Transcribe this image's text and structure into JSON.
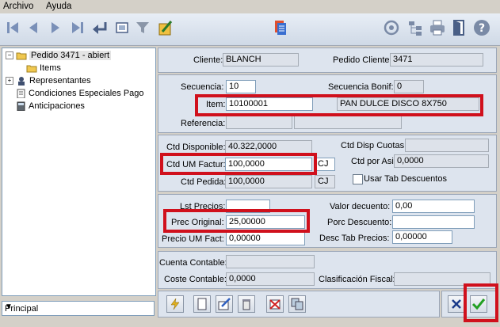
{
  "menu": {
    "archivo": "Archivo",
    "ayuda": "Ayuda"
  },
  "tree": {
    "items": [
      {
        "label": "Pedido 3471 - abiert"
      },
      {
        "label": "Items"
      },
      {
        "label": "Representantes"
      },
      {
        "label": "Condiciones Especiales Pago"
      },
      {
        "label": "Anticipaciones"
      }
    ]
  },
  "combo": {
    "value": "Principal"
  },
  "header": {
    "cliente_label": "Cliente:",
    "cliente_value": "BLANCH",
    "pedido_cliente_label": "Pedido Cliente:",
    "pedido_cliente_value": "3471"
  },
  "item_section": {
    "secuencia_label": "Secuencia:",
    "secuencia_value": "10",
    "secuencia_bonif_label": "Secuencia Bonif:",
    "secuencia_bonif_value": "0",
    "item_label": "Item:",
    "item_value": "10100001",
    "item_description": "PAN DULCE DISCO 8X750",
    "referencia_label": "Referencia:"
  },
  "qty_section": {
    "ctd_disponible_label": "Ctd Disponible:",
    "ctd_disponible_value": "40.322,0000",
    "ctd_disp_cuotas_label": "Ctd Disp Cuotas:",
    "ctd_um_factur_label": "Ctd UM Factur:",
    "ctd_um_factur_value": "100,0000",
    "ctd_um_factur_unit": "CJ",
    "ctd_por_asign_label": "Ctd por Asign:",
    "ctd_por_asign_value": "0,0000",
    "ctd_pedida_label": "Ctd Pedida:",
    "ctd_pedida_value": "100,0000",
    "ctd_pedida_unit": "CJ",
    "usar_tab_descuentos_label": "Usar Tab Descuentos"
  },
  "price_section": {
    "lst_precios_label": "Lst Precios:",
    "valor_descuento_label": "Valor decuento:",
    "valor_descuento_value": "0,00",
    "porc_descuento_label": "Porc Descuento:",
    "prec_original_label": "Prec Original:",
    "prec_original_value": "25,00000",
    "precio_um_fact_label": "Precio UM Fact:",
    "precio_um_fact_value": "0,00000",
    "desc_tab_precios_label": "Desc Tab Precios:",
    "desc_tab_precios_value": "0,00000"
  },
  "accounting": {
    "cuenta_contable_label": "Cuenta Contable:",
    "coste_contable_label": "Coste Contable:",
    "coste_contable_value": "0,0000",
    "clasificacion_fiscal_label": "Clasificación Fiscal:"
  },
  "colors": {
    "highlight": "#d0101c",
    "panel": "#dde4ee",
    "window": "#d4d0c8"
  }
}
